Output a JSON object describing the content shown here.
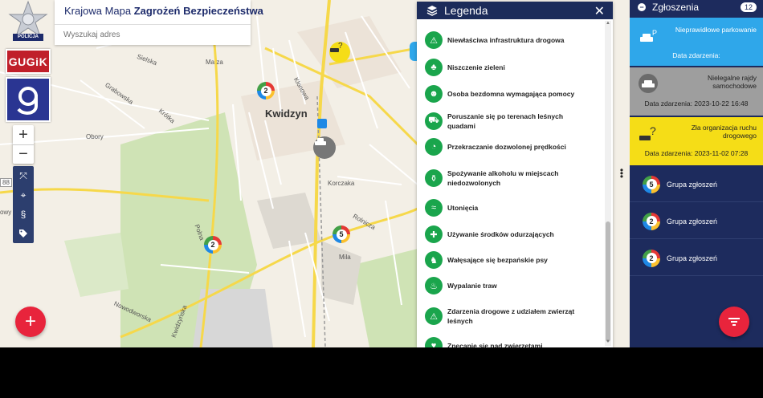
{
  "header": {
    "title_regular": "Krajowa Mapa ",
    "title_bold": "Zagrożeń Bezpieczeństwa",
    "search_placeholder": "Wyszukaj adres"
  },
  "logos": {
    "policja_text": "POLICJA",
    "gugik_text": "GUGiK"
  },
  "map_controls": {
    "zoom_in": "+",
    "zoom_out": "−",
    "add_button": "+"
  },
  "map_labels": {
    "city": "Kwidzyn",
    "obory": "Obory",
    "grabowska": "Grabowska",
    "nowodworska": "Nowodworska",
    "malszewo": "Ma za",
    "polna": "Polna",
    "rotnicza": "Rolnicza",
    "korczaka": "Korczaka",
    "mila": "Mila",
    "sielska": "Sielska",
    "krotka": "Krótka",
    "kwidzynska": "Kwidzyńska",
    "klonowa": "Klonowa",
    "road_88": "88",
    "nowy_dwor": "owy Dwór"
  },
  "clusters": [
    {
      "count": "2"
    },
    {
      "count": "2"
    },
    {
      "count": "5"
    }
  ],
  "legend": {
    "title": "Legenda",
    "close": "✕",
    "items": [
      {
        "label": "Niewłaściwa infrastruktura drogowa",
        "icon": "road-icon"
      },
      {
        "label": "Niszczenie zieleni",
        "icon": "tree-icon"
      },
      {
        "label": "Osoba bezdomna wymagająca pomocy",
        "icon": "person-icon"
      },
      {
        "label": "Poruszanie się po terenach leśnych quadami",
        "icon": "quad-icon"
      },
      {
        "label": "Przekraczanie dozwolonej prędkości",
        "icon": "speed-icon"
      },
      {
        "label": "Spożywanie alkoholu w miejscach niedozwolonych",
        "icon": "bottle-icon"
      },
      {
        "label": "Utonięcia",
        "icon": "swim-icon"
      },
      {
        "label": "Używanie środków odurzających",
        "icon": "pills-icon"
      },
      {
        "label": "Wałęsające się bezpańskie psy",
        "icon": "dog-icon"
      },
      {
        "label": "Wypalanie traw",
        "icon": "fire-icon"
      },
      {
        "label": "Zdarzenia drogowe z udziałem zwierząt leśnych",
        "icon": "deer-icon"
      },
      {
        "label": "Znęcanie się nad zwierzętami",
        "icon": "animal-icon"
      }
    ]
  },
  "panel": {
    "title": "Zgłoszenia",
    "count": "12",
    "reports": [
      {
        "title": "Nieprawidłowe parkowanie",
        "date_label": "Data zdarzenia:",
        "date": "",
        "color": "#2fa7ea"
      },
      {
        "title": "Nielegalne rajdy samochodowe",
        "date_label": "Data zdarzenia:",
        "date": "2023-10-22 16:48",
        "color": "#9e9e9e"
      },
      {
        "title": "Zła organizacja ruchu drogowego",
        "date_label": "Data zdarzenia:",
        "date": "2023-11-02 07:28",
        "color": "#f5dd17"
      }
    ],
    "groups": [
      {
        "count": "5",
        "label": "Grupa zgłoszeń"
      },
      {
        "count": "2",
        "label": "Grupa zgłoszeń"
      },
      {
        "count": "2",
        "label": "Grupa zgłoszeń"
      }
    ]
  },
  "colors": {
    "navy": "#1d2b5d",
    "legend_green": "#1aa54c",
    "fab_red": "#e8243c"
  }
}
